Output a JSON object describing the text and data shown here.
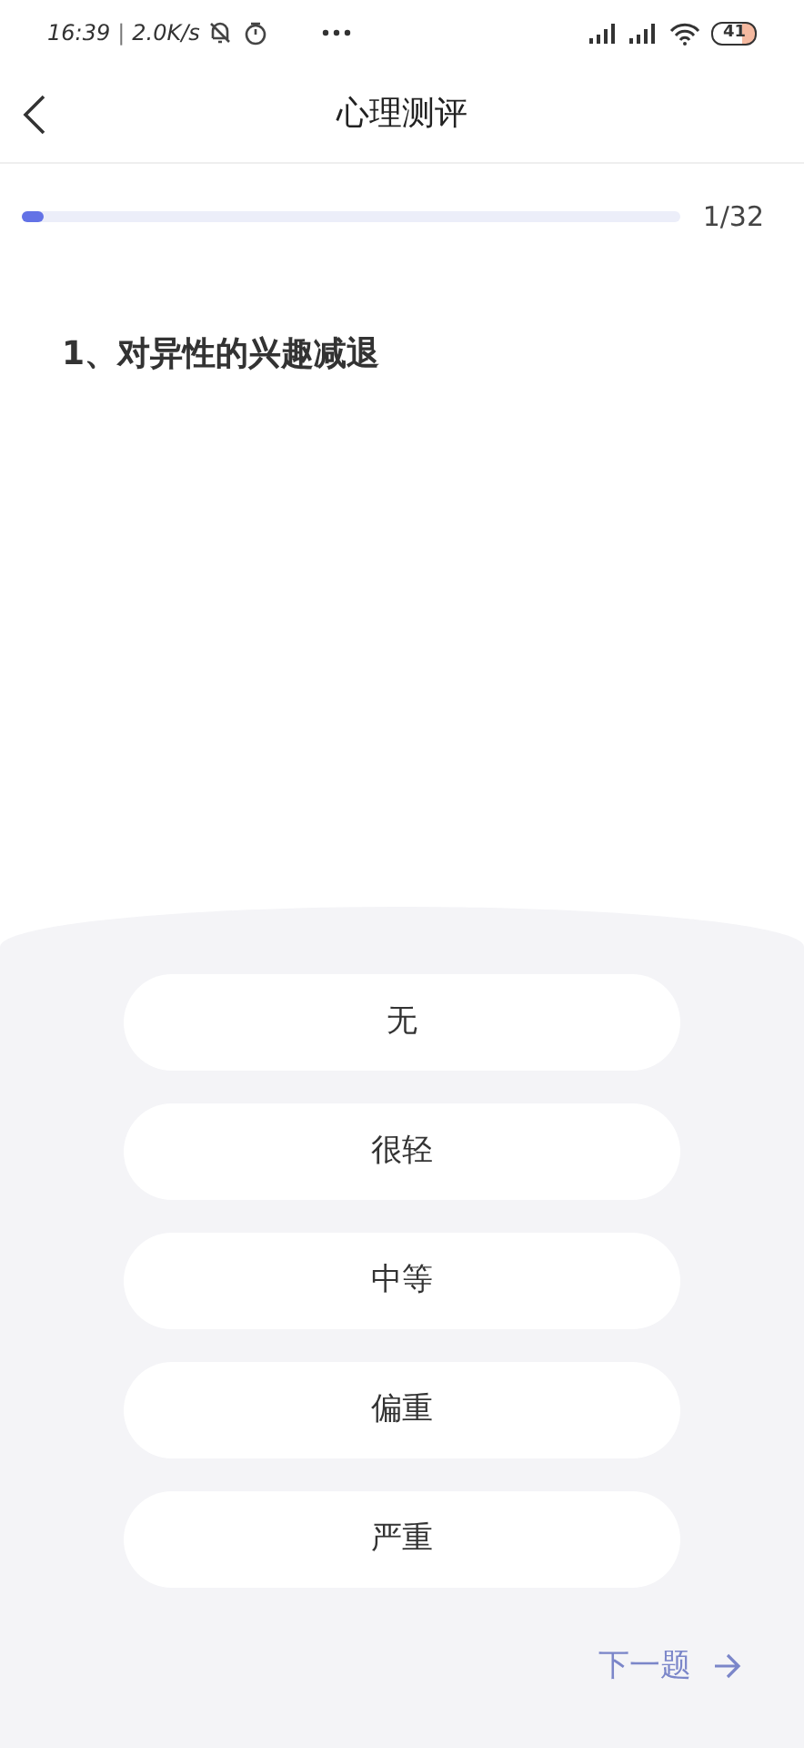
{
  "status_bar": {
    "time": "16:39",
    "separator": "|",
    "speed": "2.0K/s",
    "battery": "41"
  },
  "header": {
    "title": "心理测评"
  },
  "progress": {
    "level": 0.03,
    "reading": "1/32"
  },
  "question": {
    "text": "1、对异性的兴趣减退"
  },
  "options": [
    {
      "label": "无",
      "selected": false
    },
    {
      "label": "很轻",
      "selected": false
    },
    {
      "label": "中等",
      "selected": false
    },
    {
      "label": "偏重",
      "selected": false
    },
    {
      "label": "严重",
      "selected": false
    }
  ],
  "next_button": {
    "label": "下一题"
  }
}
